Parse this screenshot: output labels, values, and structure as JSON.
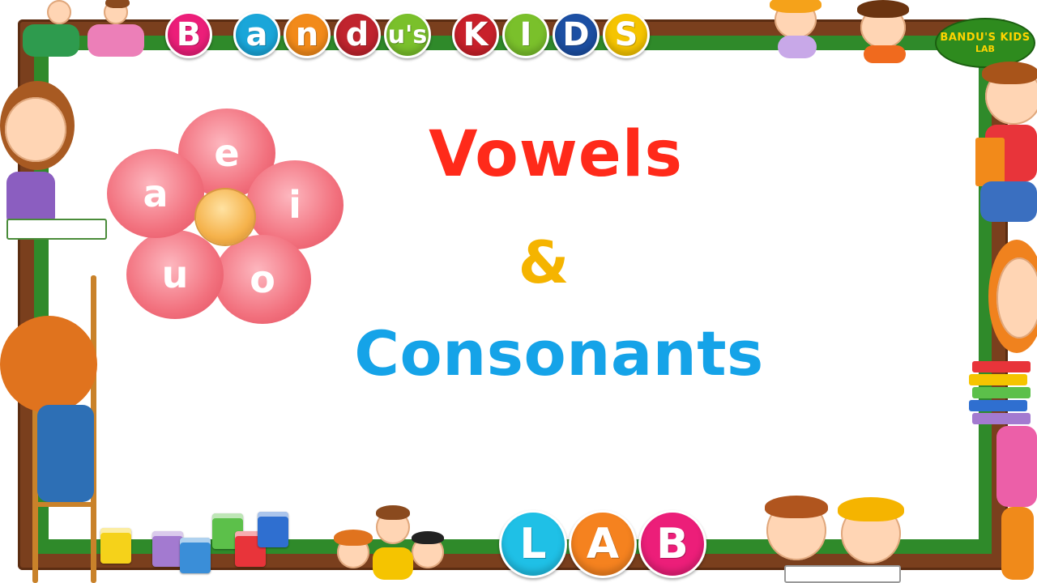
{
  "header": {
    "title_letters": [
      {
        "ch": "B",
        "color": "#ec1e79"
      },
      {
        "ch": "a",
        "color": "#1aa6d9"
      },
      {
        "ch": "n",
        "color": "#f28a1a"
      },
      {
        "ch": "d",
        "color": "#c0242e"
      },
      {
        "ch": "u's",
        "color": "#7ac02b"
      },
      {
        "ch": "K",
        "color": "#c8202a"
      },
      {
        "ch": "I",
        "color": "#7ac02b"
      },
      {
        "ch": "D",
        "color": "#1c4fa3"
      },
      {
        "ch": "S",
        "color": "#f5c400"
      }
    ]
  },
  "logo": {
    "line1": "BANDU'S KIDS",
    "line2": "LAB"
  },
  "main": {
    "vowels": "Vowels",
    "amp": "&",
    "consonants": "Consonants"
  },
  "flower": {
    "letters": [
      "e",
      "i",
      "o",
      "u",
      "a"
    ]
  },
  "footer": {
    "lab_letters": [
      {
        "ch": "L",
        "color": "#1fc0e6"
      },
      {
        "ch": "A",
        "color": "#f5821f"
      },
      {
        "ch": "B",
        "color": "#ec1e79"
      }
    ]
  },
  "colors": {
    "frame_brown": "#7a3f1d",
    "frame_green": "#2f8a2a",
    "vowels_red": "#ff2a1a",
    "amp_yellow": "#f5b400",
    "consonants_blue": "#15a3e8"
  }
}
